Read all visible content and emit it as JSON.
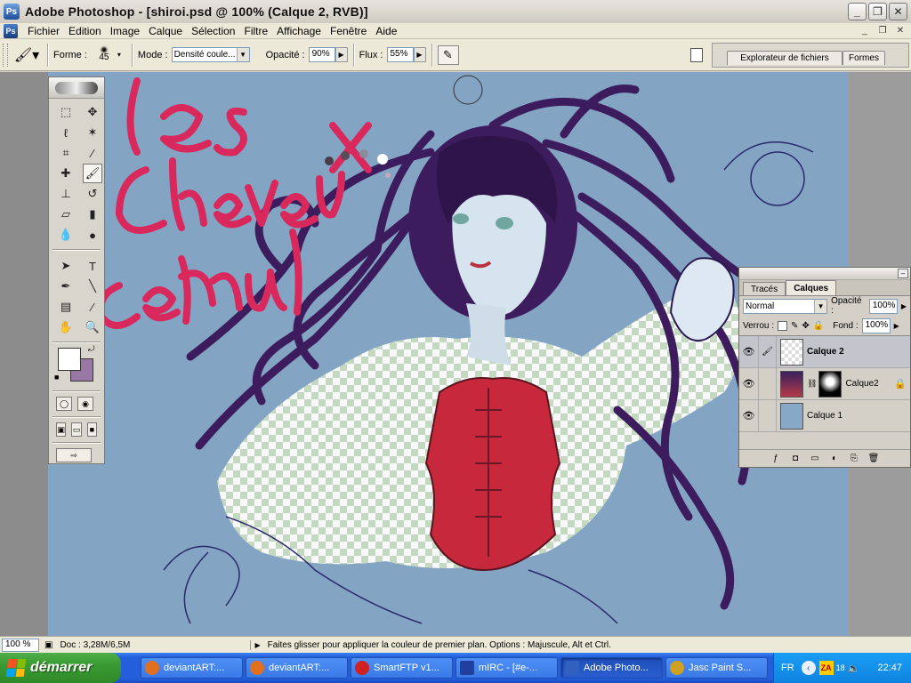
{
  "window": {
    "title": "Adobe Photoshop - [shiroi.psd @ 100% (Calque 2, RVB)]",
    "app_icon": "photoshop-icon"
  },
  "menu": {
    "items": [
      "Fichier",
      "Edition",
      "Image",
      "Calque",
      "Sélection",
      "Filtre",
      "Affichage",
      "Fenêtre",
      "Aide"
    ]
  },
  "options": {
    "forme_label": "Forme :",
    "brush_size": "45",
    "mode_label": "Mode :",
    "mode_value": "Densité coule...",
    "opacite_label": "Opacité :",
    "opacite_value": "90%",
    "flux_label": "Flux :",
    "flux_value": "55%",
    "well_tabs": [
      "Explorateur de fichiers",
      "Formes"
    ]
  },
  "canvas": {
    "background_color": "#84a4c4",
    "handwritten_text": "les Cheveux c'est mal"
  },
  "toolbox": {
    "foreground_color": "#ffffff",
    "background_color": "#9a78a6"
  },
  "layers": {
    "tabs": [
      "Tracés",
      "Calques"
    ],
    "blend_mode": "Normal",
    "opacite_label": "Opacité :",
    "opacite_value": "100%",
    "verrou_label": "Verrou :",
    "fond_label": "Fond :",
    "fond_value": "100%",
    "list": [
      {
        "name": "Calque 2",
        "selected": true
      },
      {
        "name": "Calque2",
        "selected": false
      },
      {
        "name": "Calque 1",
        "selected": false
      }
    ]
  },
  "status": {
    "zoom": "100 %",
    "doc": "Doc : 3,28M/6,5M",
    "hint": "Faites glisser pour appliquer la couleur de premier plan. Options : Majuscule, Alt et Ctrl."
  },
  "taskbar": {
    "start_label": "démarrer",
    "tasks": [
      {
        "label": "deviantART:...",
        "icon_color": "#e07020"
      },
      {
        "label": "deviantART:...",
        "icon_color": "#e07020"
      },
      {
        "label": "SmartFTP v1...",
        "icon_color": "#d02020"
      },
      {
        "label": "mIRC - [#e-...",
        "icon_color": "#2040a0"
      },
      {
        "label": "Adobe Photo...",
        "icon_color": "#3060c0",
        "active": true
      },
      {
        "label": "Jasc Paint S...",
        "icon_color": "#d0a020"
      }
    ],
    "language": "FR",
    "tray_badge": "18",
    "clock": "22:47"
  }
}
